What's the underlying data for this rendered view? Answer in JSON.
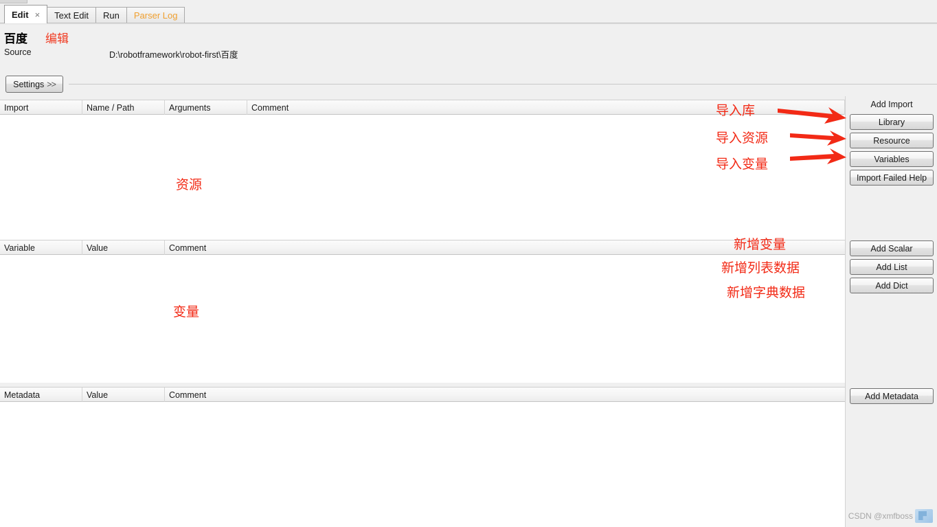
{
  "tabs": [
    {
      "label": "Edit",
      "active": true,
      "muted": false,
      "closable": true,
      "close_glyph": "×"
    },
    {
      "label": "Text Edit",
      "active": false,
      "muted": false,
      "closable": false
    },
    {
      "label": "Run",
      "active": false,
      "muted": false,
      "closable": false
    },
    {
      "label": "Parser Log",
      "active": false,
      "muted": true,
      "closable": false
    }
  ],
  "header": {
    "title": "百度",
    "title_annotation": "编辑",
    "source_label": "Source",
    "source_path": "D:\\robotframework\\robot-first\\百度"
  },
  "settings": {
    "label": "Settings",
    "chevron": ">>"
  },
  "import_table": {
    "columns": [
      "Import",
      "Name / Path",
      "Arguments",
      "Comment"
    ],
    "rows": []
  },
  "variable_table": {
    "columns": [
      "Variable",
      "Value",
      "Comment"
    ],
    "rows": []
  },
  "metadata_table": {
    "columns": [
      "Metadata",
      "Value",
      "Comment"
    ],
    "rows": []
  },
  "right_panel": {
    "add_import_title": "Add Import",
    "buttons": {
      "library": "Library",
      "resource": "Resource",
      "variables": "Variables",
      "import_failed_help": "Import Failed Help",
      "add_scalar": "Add Scalar",
      "add_list": "Add List",
      "add_dict": "Add Dict",
      "add_metadata": "Add Metadata"
    }
  },
  "annotations": {
    "import_library": "导入库",
    "import_resource": "导入资源",
    "import_variables": "导入变量",
    "resource_area": "资源",
    "variable_area": "变量",
    "add_variable": "新增变量",
    "add_list_data": "新增列表数据",
    "add_dict_data": "新增字典数据",
    "color": "#f22a16"
  },
  "watermark": {
    "text": "CSDN @xmfboss"
  }
}
